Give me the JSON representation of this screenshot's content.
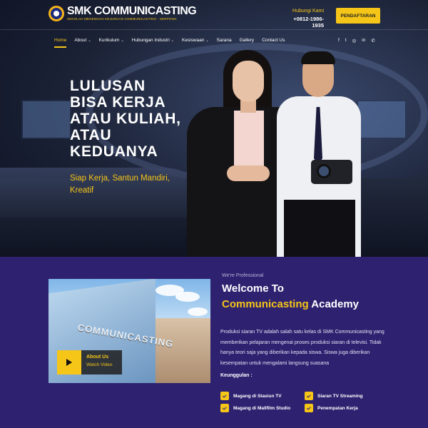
{
  "header": {
    "logo_title": "SMK COMMUNICASTING",
    "logo_subtitle": "SEKOLAH MENENGAH KEJURUAN COMMUNICASTING - SERPONG",
    "contact_label": "Hubungi Kami",
    "contact_phone": "+0812-1986-1935",
    "cta_label": "PENDAFTARAN"
  },
  "nav": {
    "items": [
      {
        "label": "Home",
        "has_caret": false
      },
      {
        "label": "About",
        "has_caret": true
      },
      {
        "label": "Kurikulum",
        "has_caret": true
      },
      {
        "label": "Hubungan Industri",
        "has_caret": true
      },
      {
        "label": "Kesiswaan",
        "has_caret": true
      },
      {
        "label": "Sarana",
        "has_caret": false
      },
      {
        "label": "Gallery",
        "has_caret": false
      },
      {
        "label": "Contact Us",
        "has_caret": false
      }
    ],
    "caret": "⌄",
    "social": [
      "f",
      "t",
      "◎",
      "in",
      "✆"
    ]
  },
  "hero": {
    "headline": [
      "LULUSAN",
      "BISA KERJA",
      "ATAU KULIAH,",
      "ATAU",
      "KEDUANYA"
    ],
    "tagline": "Siap Kerja, Santun Mandiri, Kreatif"
  },
  "about": {
    "photo_sign": "COMMUNICASTING",
    "button_title": "About Us",
    "button_sub": "Watch Video",
    "eyebrow": "We're Professional",
    "title_line1": "Welcome To",
    "title_highlight": "Communicasting",
    "title_rest": " Academy",
    "description": "Produksi siaran TV adalah salah satu kelas di SMK Communicasting yang memberikan pelajaran mengenai proses produksi siaran di televisi. Tidak hanya teori saja yang diberikan kepada siswa. Siswa juga diberikan kesempatan untuk mengalami langsung suasana",
    "features_heading": "Keunggulan :",
    "features": [
      "Magang di Stasiun TV",
      "Siaran TV Streaming",
      "Magang di Mallfilm Studio",
      "Penempatan Kerja"
    ]
  },
  "colors": {
    "accent": "#f5c518",
    "section_bg": "#2e2170"
  }
}
